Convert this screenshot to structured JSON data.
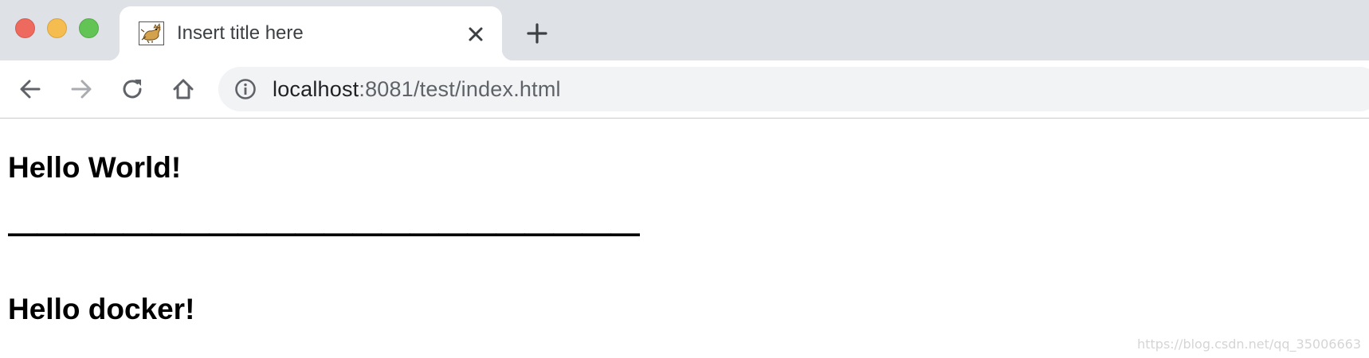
{
  "window": {
    "traffic_lights": [
      "close",
      "minimize",
      "zoom"
    ],
    "colors": {
      "close": "#ee6a5f",
      "minimize": "#f5bd4f",
      "zoom": "#61c454"
    }
  },
  "tab": {
    "title": "Insert title here",
    "favicon": "tomcat-icon",
    "close_icon": "close-icon"
  },
  "new_tab_icon": "plus-icon",
  "toolbar": {
    "icons": [
      "back-arrow-icon",
      "forward-arrow-icon",
      "reload-icon",
      "home-icon"
    ],
    "forward_disabled": true
  },
  "omnibox": {
    "icon": "info-icon",
    "host": "localhost",
    "rest": ":8081/test/index.html"
  },
  "page": {
    "heading_1": "Hello World!",
    "separator": "——————————————————————",
    "heading_2": "Hello docker!"
  },
  "watermark": "https://blog.csdn.net/qq_35006663"
}
